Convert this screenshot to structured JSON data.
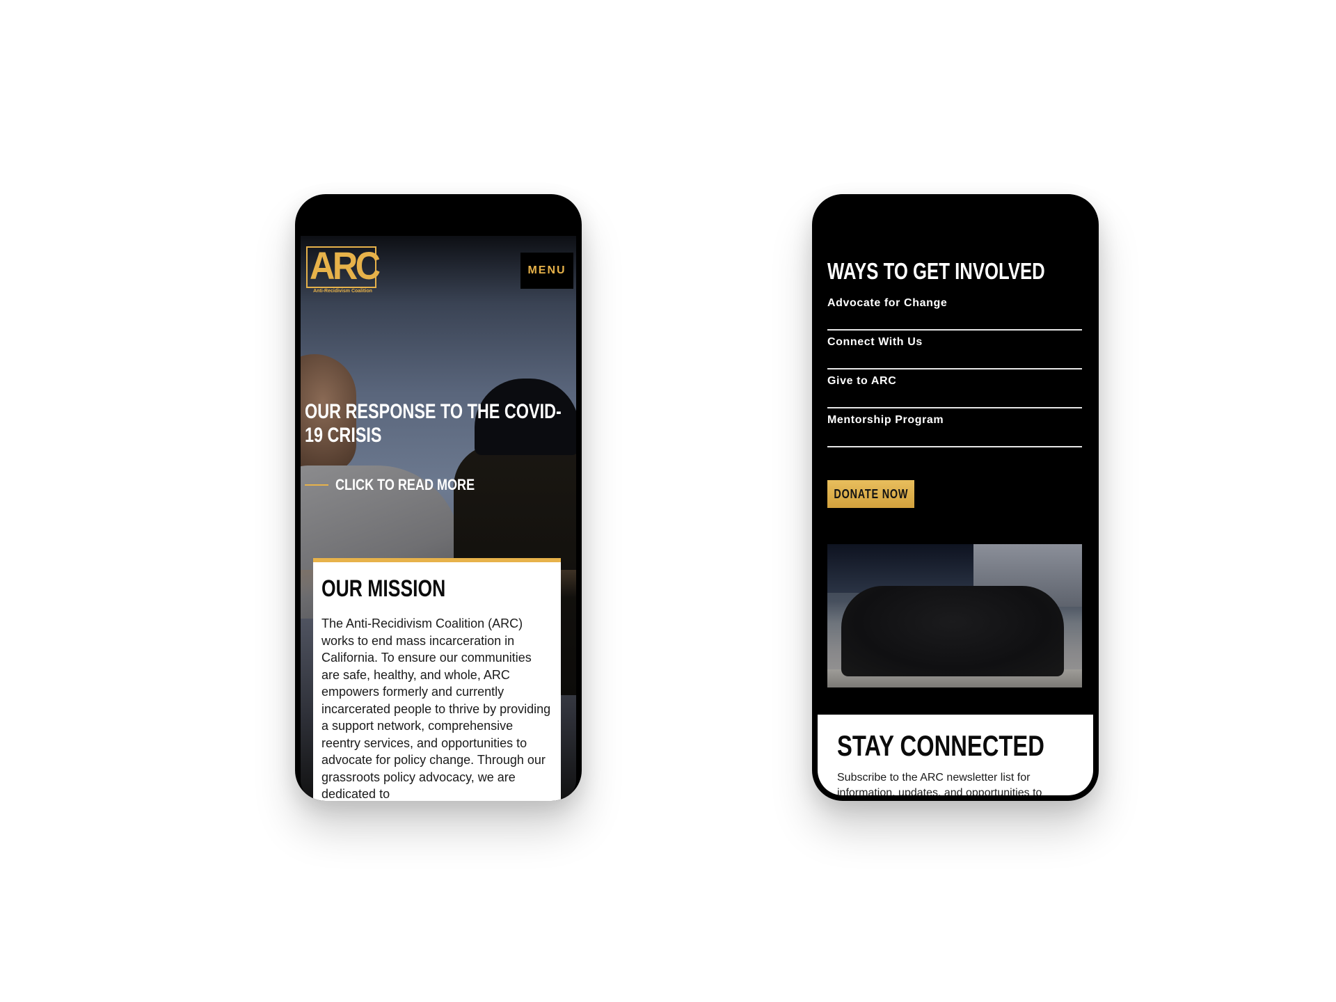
{
  "left_screen": {
    "logo": {
      "text": "ARC",
      "subtitle": "Anti-Recidivism Coalition"
    },
    "menu_label": "MENU",
    "hero": {
      "title": "OUR RESPONSE TO THE COVID-19 CRISIS",
      "link_label": "CLICK TO READ MORE"
    },
    "mission": {
      "title": "OUR MISSION",
      "body": "The Anti-Recidivism Coalition (ARC) works to end mass incarceration in California. To ensure our communities are safe, healthy, and whole, ARC empowers formerly and currently incarcerated people to thrive by providing a support network, comprehensive reentry services, and opportunities to advocate for policy change. Through our grassroots policy advocacy, we are dedicated to"
    }
  },
  "right_screen": {
    "involved": {
      "title": "WAYS TO GET INVOLVED",
      "items": [
        {
          "label": "Advocate for Change"
        },
        {
          "label": "Connect With Us"
        },
        {
          "label": "Give to ARC"
        },
        {
          "label": "Mentorship Program"
        }
      ]
    },
    "donate_label": "DONATE NOW",
    "connect": {
      "title": "STAY CONNECTED",
      "body": "Subscribe to the ARC newsletter list for information, updates, and opportunities to"
    }
  },
  "colors": {
    "accent_gold": "#e7b24a",
    "phone_frame": "#000000",
    "card_bg": "#ffffff"
  }
}
